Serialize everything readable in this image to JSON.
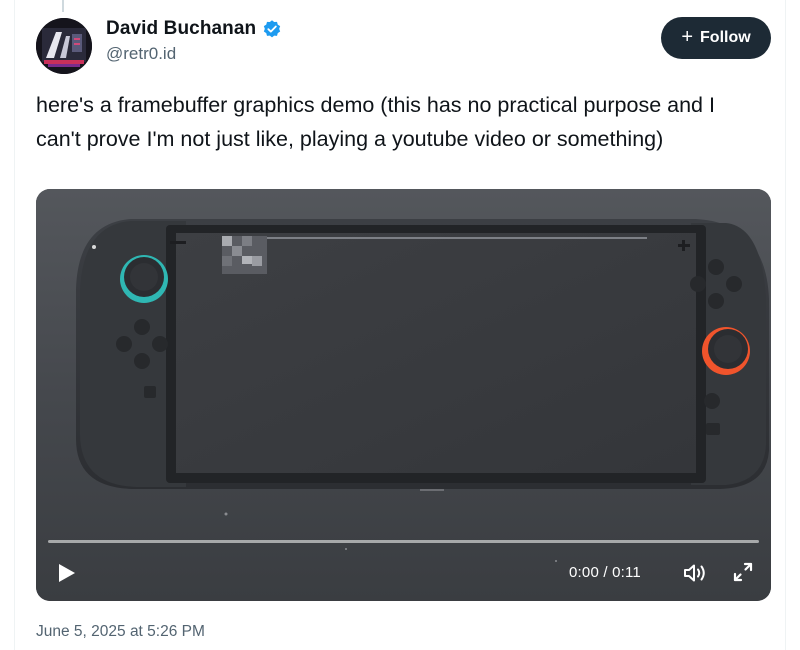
{
  "author": {
    "name": "David Buchanan",
    "handle": "@retr0.id",
    "verified": true
  },
  "follow_button": {
    "icon": "plus-icon",
    "label": "Follow"
  },
  "tweet": {
    "text": "here's a framebuffer graphics demo (this has no practical purpose and I can't prove I'm not just like, playing a youtube video or something)",
    "timestamp": "June 5, 2025 at 5:26 PM"
  },
  "video": {
    "time_display": "0:00 / 0:11",
    "progress": 0,
    "controls": [
      "play-icon",
      "volume-icon",
      "fullscreen-icon"
    ]
  },
  "colors": {
    "text_primary": "#0f1419",
    "text_secondary": "#536471",
    "follow_bg": "#1d2a35",
    "verified": "#1d9bf0",
    "joycon_left_accent": "#2fb7b3",
    "joycon_right_accent": "#f0542c"
  }
}
